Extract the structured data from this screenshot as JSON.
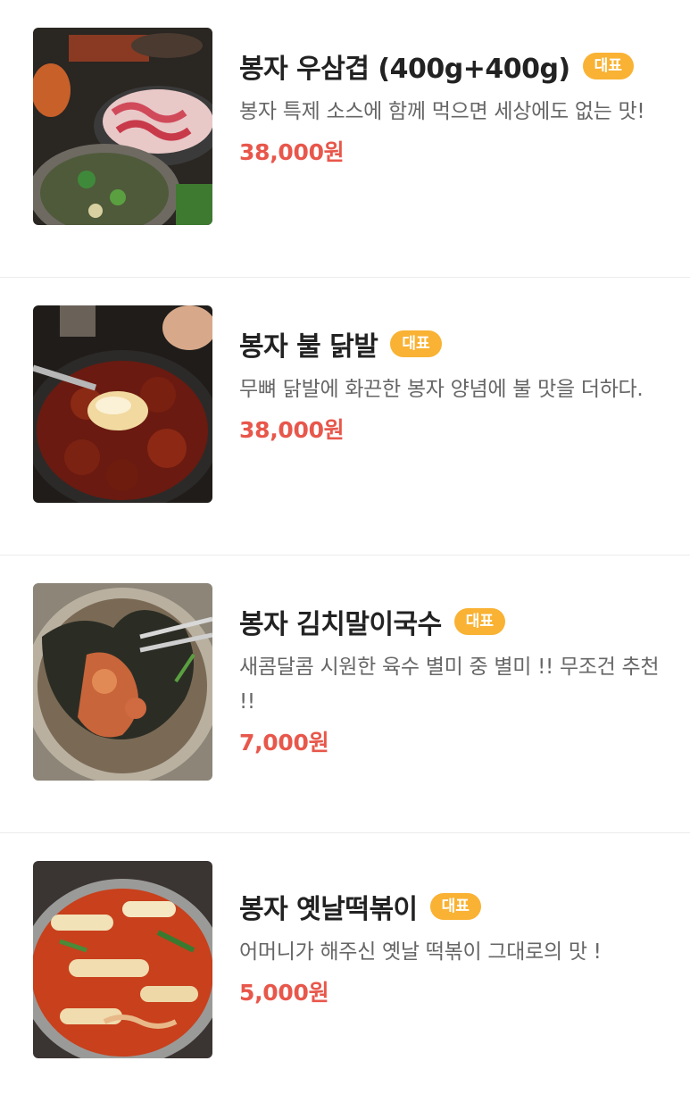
{
  "menu": {
    "items": [
      {
        "name": "봉자 우삼겹 (400g+400g)",
        "badge": "대표",
        "description": "봉자 특제 소스에 함께 먹으면 세상에도 없는 맛!",
        "price": "38,000원",
        "image": "beef-brisket-grill-photo"
      },
      {
        "name": "봉자 불 닭발",
        "badge": "대표",
        "description": "무뼈 닭발에 화끈한 봉자 양념에 불 맛을 더하다.",
        "price": "38,000원",
        "image": "spicy-chicken-feet-photo"
      },
      {
        "name": "봉자 김치말이국수",
        "badge": "대표",
        "description": "새콤달콤 시원한 육수 별미 중 별미 !! 무조건 추천 !!",
        "price": "7,000원",
        "image": "kimchi-noodle-photo"
      },
      {
        "name": "봉자 옛날떡볶이",
        "badge": "대표",
        "description": "어머니가 해주신 옛날 떡볶이 그대로의 맛 !",
        "price": "5,000원",
        "image": "tteokbokki-photo"
      }
    ]
  },
  "colors": {
    "badge": "#f9b233",
    "price": "#e8574b",
    "title": "#222222",
    "description": "#666666",
    "divider": "#ececec"
  }
}
